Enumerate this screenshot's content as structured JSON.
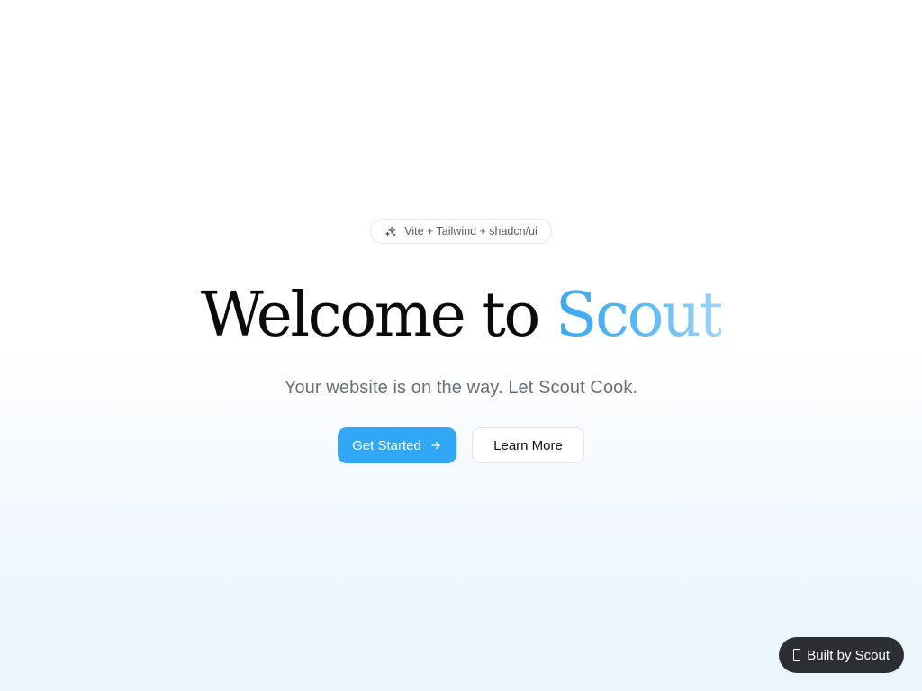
{
  "badge": {
    "icon": "sparkles-icon",
    "label": "Vite + Tailwind + shadcn/ui"
  },
  "hero": {
    "title_prefix": "Welcome to ",
    "title_accent": "Scout",
    "subtitle": "Your website is on the way. Let Scout Cook."
  },
  "actions": {
    "primary_label": "Get Started",
    "primary_icon": "arrow-right-icon",
    "secondary_label": "Learn More"
  },
  "footer_badge": {
    "icon": "scout-logo-icon",
    "label": "Built by Scout"
  },
  "colors": {
    "accent": "#31a8f5",
    "title": "#0b0b0b",
    "subtitle": "#6b7078",
    "footer_badge_bg": "#2b2f33"
  }
}
